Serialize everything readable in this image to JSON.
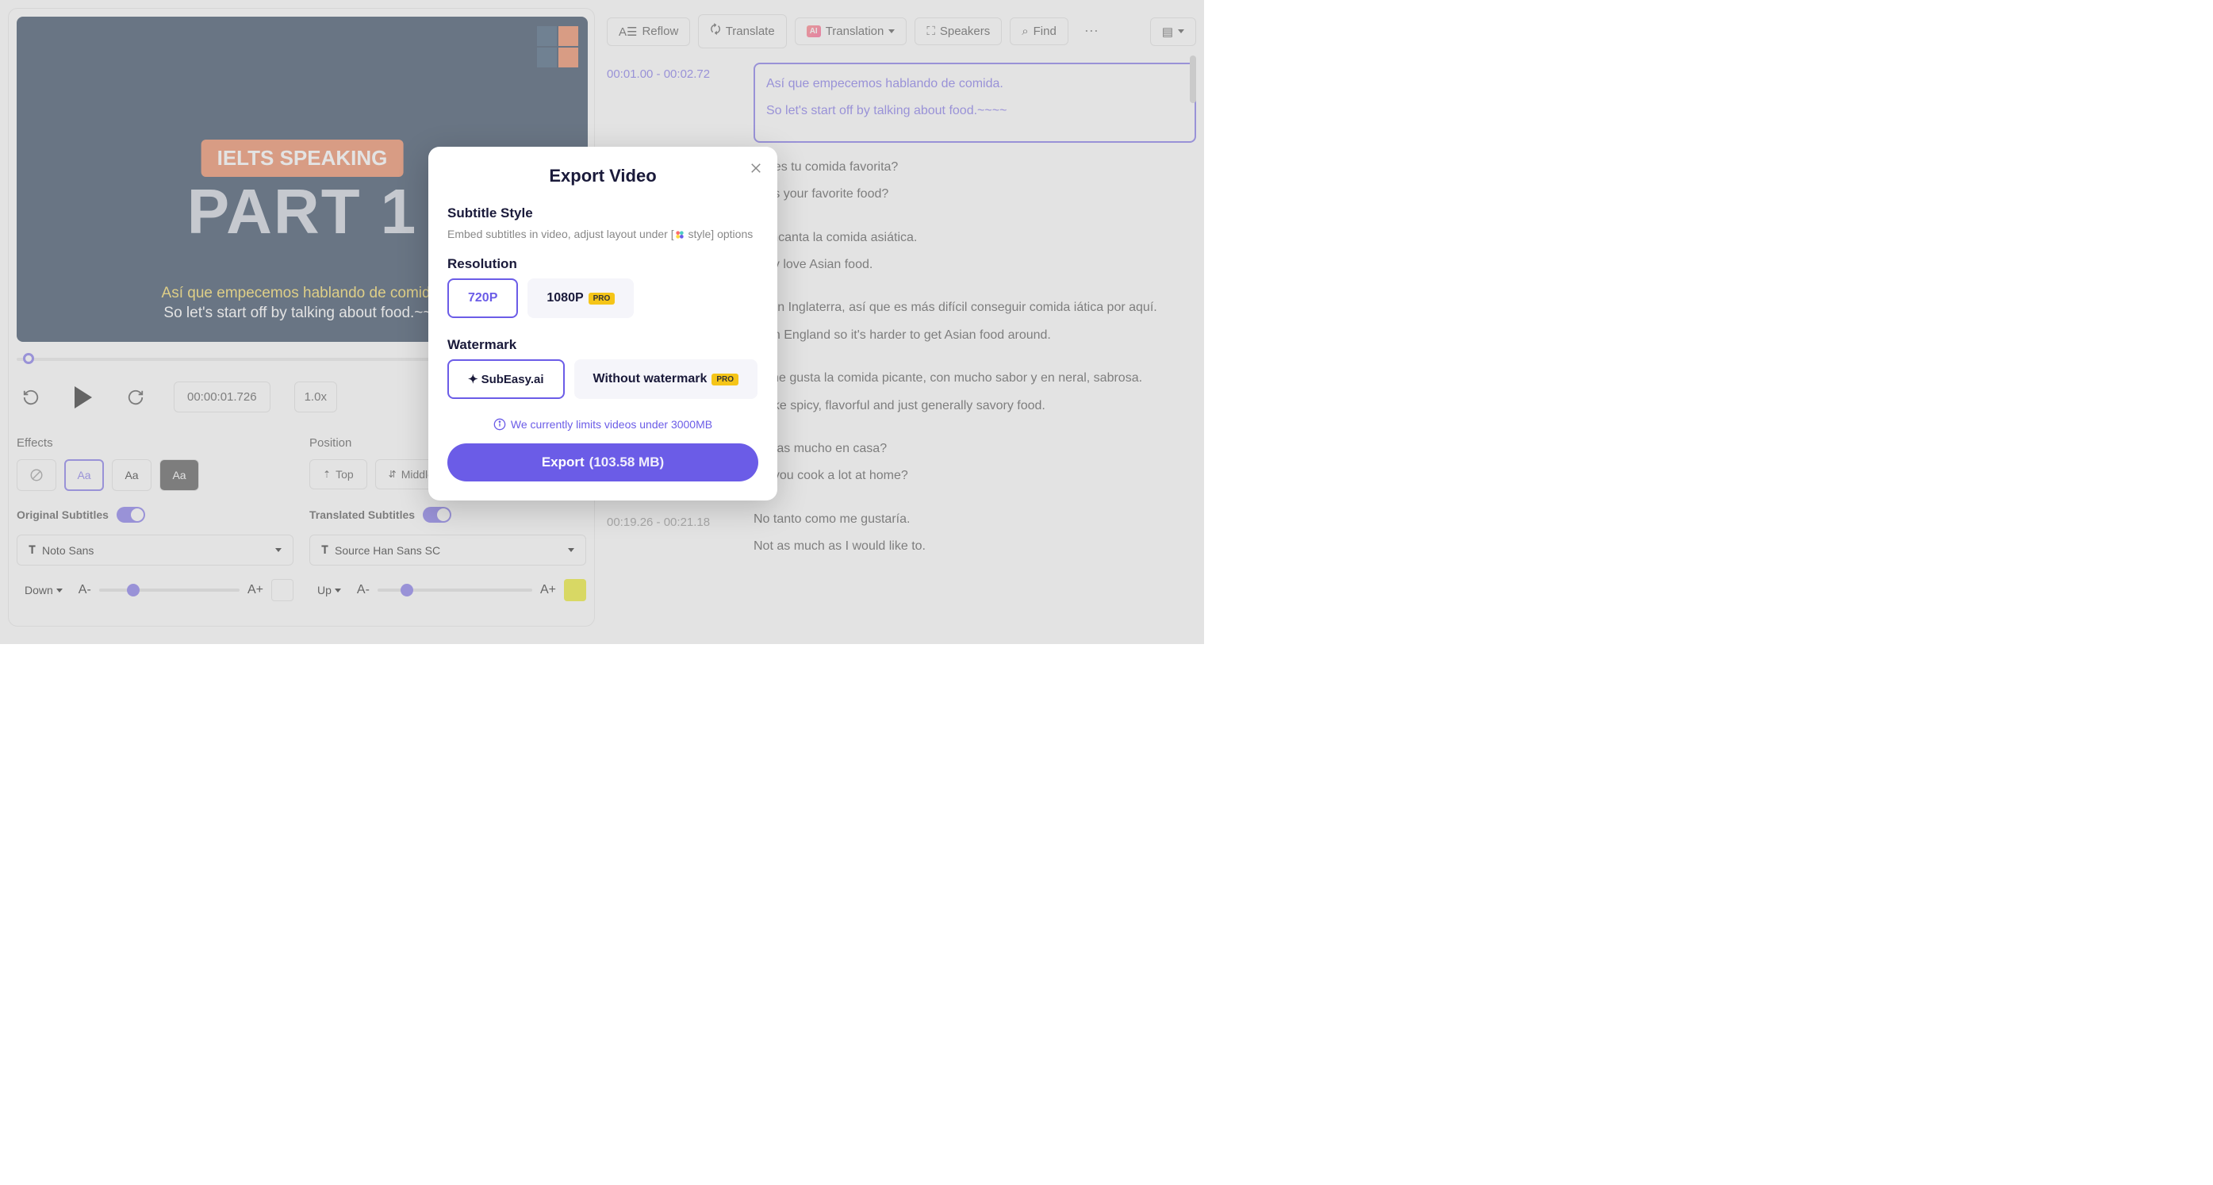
{
  "video": {
    "badge": "IELTS SPEAKING",
    "big_title": "PART 1",
    "subtitle_translated": "Así que empecemos hablando de comida.",
    "subtitle_original": "So let's start off by talking about food.~~~"
  },
  "playback": {
    "current_time": "00:00:01.726",
    "speed": "1.0x"
  },
  "settings": {
    "effects_label": "Effects",
    "effect_aa": "Aa",
    "position_label": "Position",
    "pos_top": "Top",
    "pos_middle": "Middle",
    "original_subs_label": "Original Subtitles",
    "translated_subs_label": "Translated Subtitles",
    "font_original": "Noto Sans",
    "font_translated": "Source Han Sans SC",
    "size_down": "Down",
    "size_up": "Up",
    "size_minus": "A-",
    "size_plus": "A+",
    "color_original": "#ffffff",
    "color_translated": "#e8e800"
  },
  "toolbar": {
    "reflow": "Reflow",
    "translate": "Translate",
    "translation": "Translation",
    "speakers": "Speakers",
    "find": "Find"
  },
  "transcript": [
    {
      "time": "00:01.00  -  00:02.72",
      "active": true,
      "translated": "Así que empecemos hablando de comida.",
      "original": "So let's start off by talking about food.~~~~"
    },
    {
      "time": "",
      "translated": "uál es tu comida favorita?",
      "original": "hat's your favorite food?"
    },
    {
      "time": "",
      "translated": "e encanta la comida asiática.",
      "original": "eally love Asian food."
    },
    {
      "time": "",
      "translated": "vo en Inglaterra, así que es más difícil conseguir comida iática por aquí.",
      "original": "ve in England so it's harder to get Asian food around."
    },
    {
      "time": "",
      "translated": "ro me gusta la comida picante, con mucho sabor y en neral, sabrosa.",
      "original": "t I like spicy, flavorful and just generally savory food."
    },
    {
      "time": "",
      "translated": "ocinas mucho en casa?",
      "original": "Do you cook a lot at home?"
    },
    {
      "time": "00:19.26  -  00:21.18",
      "translated": "No tanto como me gustaría.",
      "original": "Not as much as I would like to."
    }
  ],
  "modal": {
    "title": "Export Video",
    "subtitle_style_title": "Subtitle Style",
    "subtitle_style_desc_pre": "Embed subtitles in video, adjust layout under [",
    "subtitle_style_desc_post": " style] options",
    "resolution_title": "Resolution",
    "res_720": "720P",
    "res_1080": "1080P",
    "pro_label": "PRO",
    "watermark_title": "Watermark",
    "watermark_brand": "SubEasy.ai",
    "watermark_without": "Without watermark",
    "limit_note": "We currently limits videos under 3000MB",
    "export_label": "Export",
    "export_size": "(103.58 MB)"
  }
}
